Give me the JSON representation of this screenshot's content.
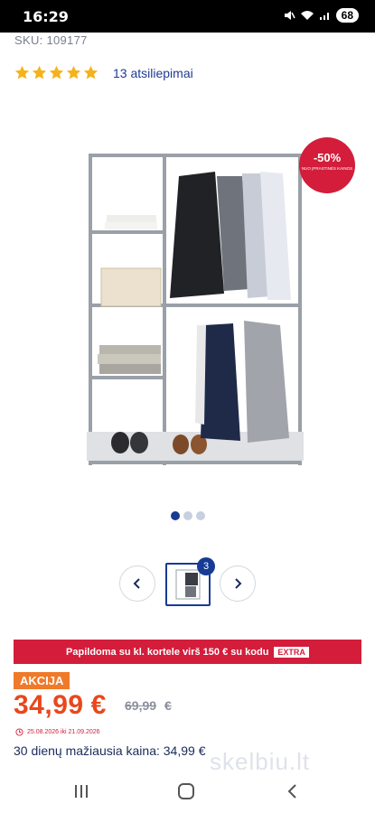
{
  "status": {
    "time": "16:29",
    "battery": "68"
  },
  "product": {
    "sku": "SKU: 109177",
    "rating": 5,
    "reviews": "13 atsiliepimai",
    "discount_badge": "-50%",
    "discount_subtext": "NUO ĮPRASTINĖS KAINOS"
  },
  "gallery": {
    "active_dot": 0,
    "dot_count": 3,
    "thumb_badge": "3"
  },
  "promo": {
    "text": "Papildoma su kl. kortele virš 150 € su kodu",
    "code": "EXTRA"
  },
  "pricing": {
    "badge": "AKCIJA",
    "price": "34,99",
    "currency": "€",
    "old_price": "69,99",
    "old_currency": "€",
    "dates": "25.08.2026 iki 21.09.2026",
    "lowest_30": "30 dienų mažiausia kaina: 34,99 €"
  },
  "watermark": "skelbiu.lt",
  "colors": {
    "brand_blue": "#173b94",
    "sale_red": "#d31d3b",
    "price_orange": "#e8481c",
    "akcija_orange": "#f07a2a"
  }
}
